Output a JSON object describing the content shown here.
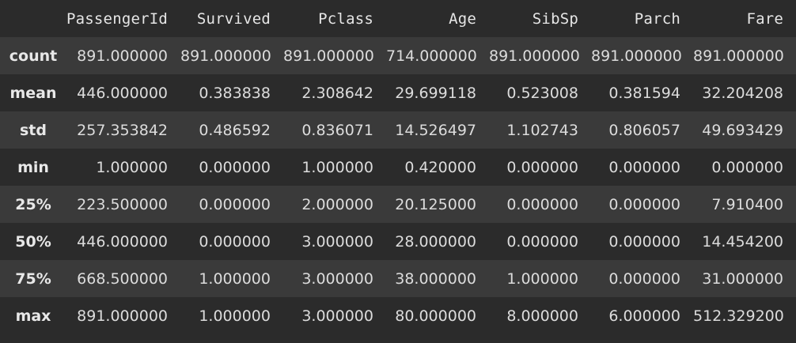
{
  "table": {
    "columns": [
      "PassengerId",
      "Survived",
      "Pclass",
      "Age",
      "SibSp",
      "Parch",
      "Fare"
    ],
    "rows": [
      {
        "index": "count",
        "values": [
          "891.000000",
          "891.000000",
          "891.000000",
          "714.000000",
          "891.000000",
          "891.000000",
          "891.000000"
        ]
      },
      {
        "index": "mean",
        "values": [
          "446.000000",
          "0.383838",
          "2.308642",
          "29.699118",
          "0.523008",
          "0.381594",
          "32.204208"
        ]
      },
      {
        "index": "std",
        "values": [
          "257.353842",
          "0.486592",
          "0.836071",
          "14.526497",
          "1.102743",
          "0.806057",
          "49.693429"
        ]
      },
      {
        "index": "min",
        "values": [
          "1.000000",
          "0.000000",
          "1.000000",
          "0.420000",
          "0.000000",
          "0.000000",
          "0.000000"
        ]
      },
      {
        "index": "25%",
        "values": [
          "223.500000",
          "0.000000",
          "2.000000",
          "20.125000",
          "0.000000",
          "0.000000",
          "7.910400"
        ]
      },
      {
        "index": "50%",
        "values": [
          "446.000000",
          "0.000000",
          "3.000000",
          "28.000000",
          "0.000000",
          "0.000000",
          "14.454200"
        ]
      },
      {
        "index": "75%",
        "values": [
          "668.500000",
          "1.000000",
          "3.000000",
          "38.000000",
          "1.000000",
          "0.000000",
          "31.000000"
        ]
      },
      {
        "index": "max",
        "values": [
          "891.000000",
          "1.000000",
          "3.000000",
          "80.000000",
          "8.000000",
          "6.000000",
          "512.329200"
        ]
      }
    ]
  }
}
